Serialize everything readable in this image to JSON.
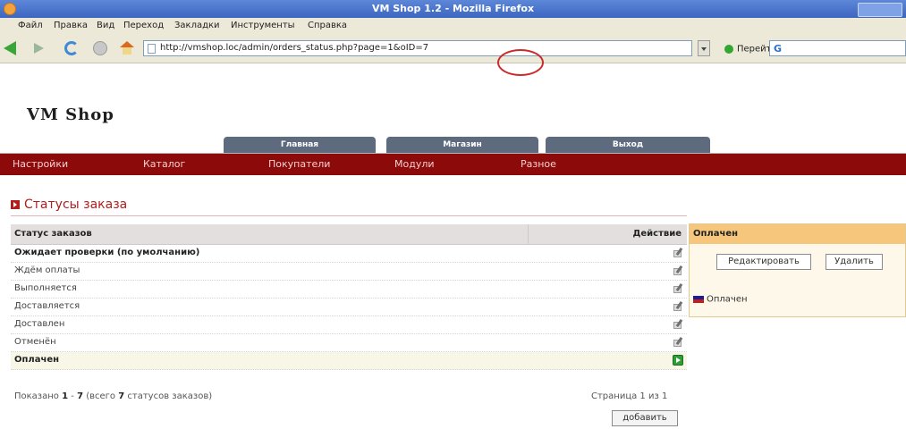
{
  "window": {
    "title": "VM Shop 1.2 - Mozilla Firefox"
  },
  "menu": [
    "Файл",
    "Правка",
    "Вид",
    "Переход",
    "Закладки",
    "Инструменты",
    "Справка"
  ],
  "toolbar": {
    "url": "http://vmshop.loc/admin/orders_status.php?page=1&oID=7",
    "go_label": "Перейти",
    "search_placeholder": ""
  },
  "site": {
    "logo": "VM Shop",
    "top_tabs": [
      "Главная",
      "Магазин",
      "Выход"
    ],
    "nav": [
      "Настройки",
      "Каталог",
      "Покупатели",
      "Модули",
      "Разное"
    ]
  },
  "page": {
    "title": "Статусы заказа",
    "table": {
      "col_status": "Статус заказов",
      "col_action": "Действие",
      "rows": [
        {
          "name": "Ожидает проверки (по умолчанию)",
          "bold": true
        },
        {
          "name": "Ждём оплаты",
          "bold": false
        },
        {
          "name": "Выполняется",
          "bold": false
        },
        {
          "name": "Доставляется",
          "bold": false
        },
        {
          "name": "Доставлен",
          "bold": false
        },
        {
          "name": "Отменён",
          "bold": false
        },
        {
          "name": "Оплачен",
          "bold": true,
          "selected": true
        }
      ]
    },
    "footer": {
      "shown_prefix": "Показано",
      "shown_from": "1",
      "dash": "-",
      "shown_to": "7",
      "total_prefix": "(всего",
      "total": "7",
      "total_suffix": "статусов заказов)",
      "pages": "Страница 1 из 1",
      "add_button": "добавить"
    }
  },
  "panel": {
    "title": "Оплачен",
    "edit_button": "Редактировать",
    "delete_button": "Удалить",
    "language_label": "Оплачен"
  },
  "colors": {
    "nav_bar": "#8d0a0a",
    "heading": "#b11d1d",
    "tab": "#5e6b7f",
    "panel_header": "#f5c67b",
    "highlight_circle": "#cc2a2a"
  }
}
